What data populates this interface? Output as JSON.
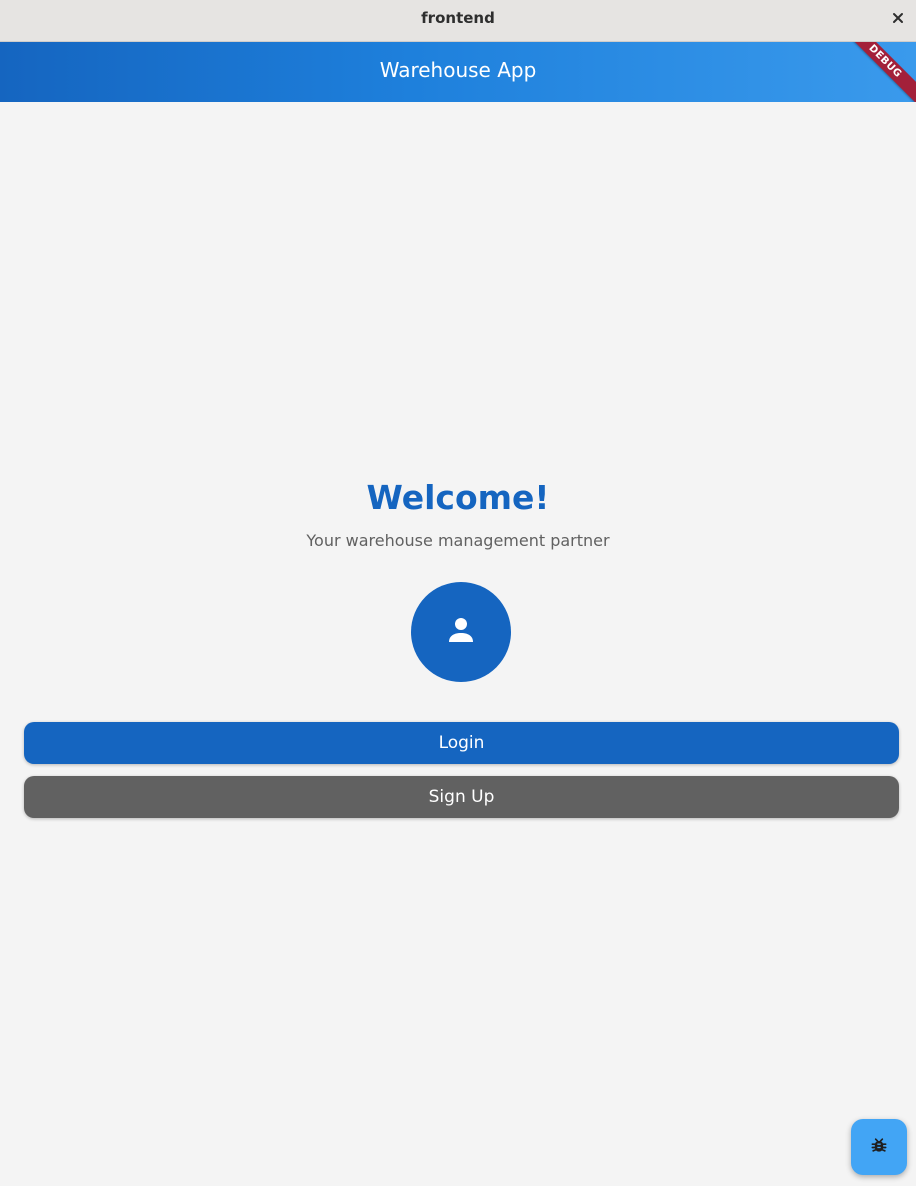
{
  "window": {
    "title": "frontend",
    "close_icon": "close-icon"
  },
  "appbar": {
    "title": "Warehouse App",
    "debug_label": "DEBUG"
  },
  "main": {
    "heading": "Welcome!",
    "subtitle": "Your warehouse management partner",
    "avatar_icon": "person-icon",
    "login_label": "Login",
    "signup_label": "Sign Up"
  },
  "fab": {
    "icon": "bug-icon"
  },
  "colors": {
    "primary": "#1565c0",
    "secondary_button": "#616161",
    "fab": "#42a5f5",
    "debug_banner": "#a3203a",
    "background": "#f4f4f4"
  }
}
